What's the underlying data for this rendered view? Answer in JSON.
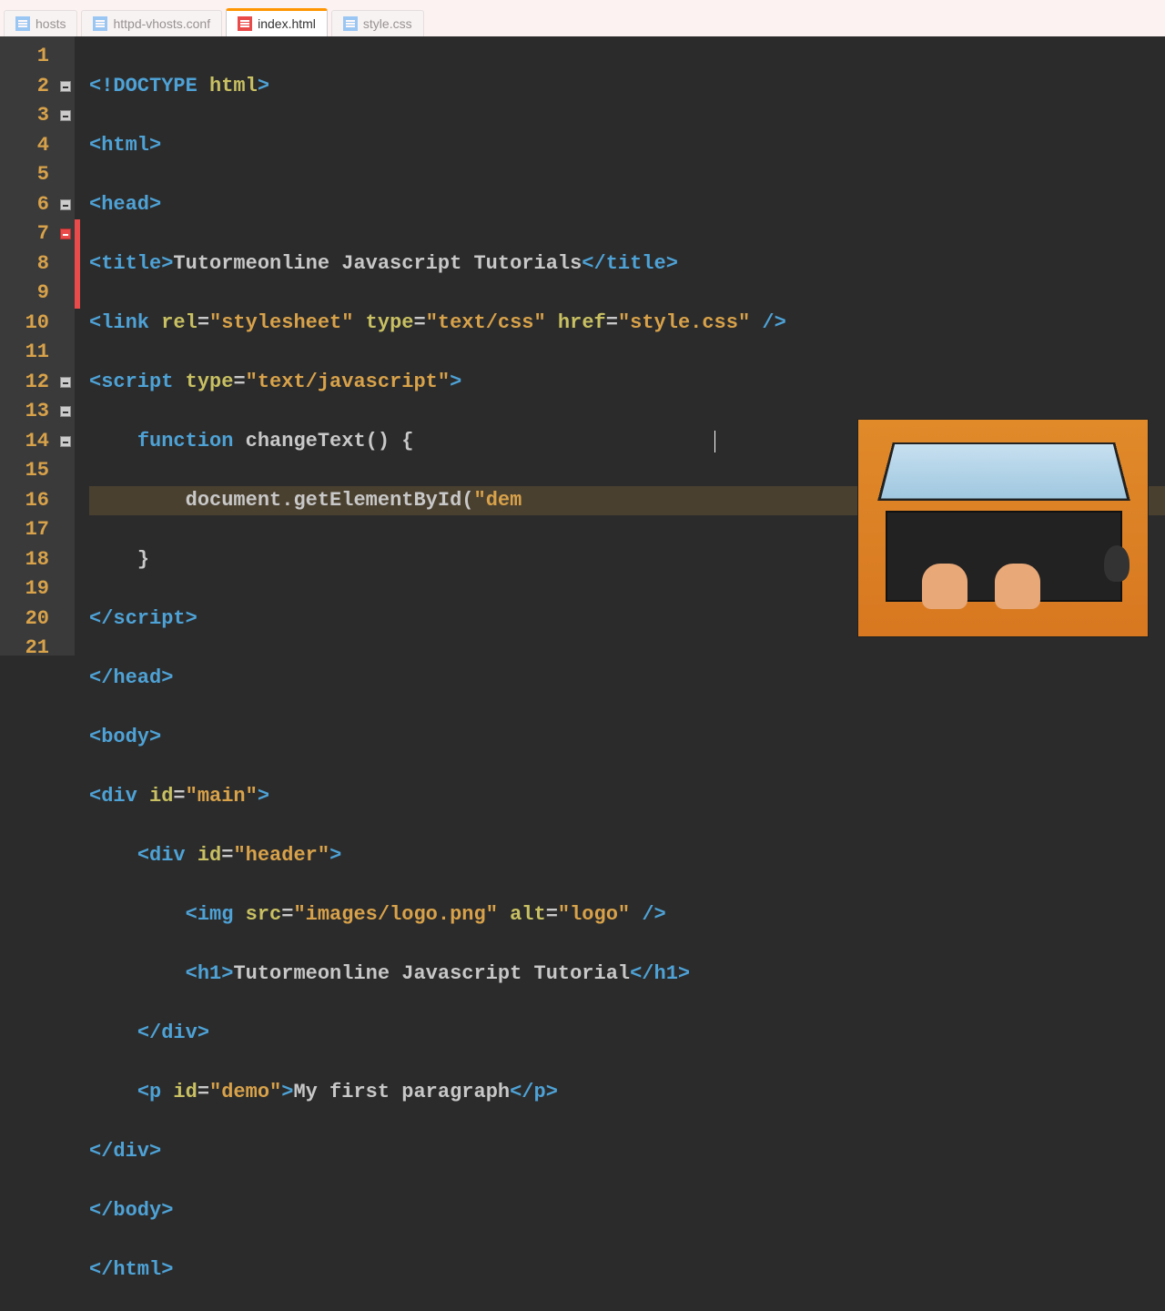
{
  "tabs": [
    {
      "label": "hosts",
      "iconColor": "blue",
      "dim": true
    },
    {
      "label": "httpd-vhosts.conf",
      "iconColor": "blue",
      "dim": true
    },
    {
      "label": "index.html",
      "iconColor": "red",
      "active": true
    },
    {
      "label": "style.css",
      "iconColor": "blue",
      "dim": true
    }
  ],
  "line_numbers": [
    "1",
    "2",
    "3",
    "4",
    "5",
    "6",
    "7",
    "8",
    "9",
    "10",
    "11",
    "12",
    "13",
    "14",
    "15",
    "16",
    "17",
    "18",
    "19",
    "20",
    "21"
  ],
  "fold_markers": {
    "2": "minus",
    "3": "minus",
    "6": "minus",
    "7": "minus-red",
    "12": "minus",
    "13": "minus",
    "14": "minus"
  },
  "change_marks": [
    "7",
    "8",
    "9"
  ],
  "highlighted_line": 8,
  "code": {
    "l1": {
      "t1": "<!DOCTYPE",
      "a1": " html",
      "t2": ">"
    },
    "l2": {
      "t1": "<html>"
    },
    "l3": {
      "t1": "<head>"
    },
    "l4": {
      "t1": "<title>",
      "x1": "Tutormeonline Javascript Tutorials",
      "t2": "</title>"
    },
    "l5": {
      "t1": "<link",
      "a1": " rel",
      "e1": "=",
      "s1": "\"stylesheet\"",
      "a2": " type",
      "e2": "=",
      "s2": "\"text/css\"",
      "a3": " href",
      "e3": "=",
      "s3": "\"style.css\"",
      "t2": " />"
    },
    "l6": {
      "t1": "<script",
      "a1": " type",
      "e1": "=",
      "s1": "\"text/javascript\"",
      "t2": ">"
    },
    "l7": {
      "indent": "    ",
      "k1": "function",
      "sp": " ",
      "fn1": "changeText",
      "p1": "()",
      "sp2": " ",
      "b1": "{"
    },
    "l8": {
      "indent": "        ",
      "fn1": "document",
      "d1": ".",
      "fn2": "getElementById",
      "p1": "(",
      "s1": "\"dem"
    },
    "l9": {
      "indent": "    ",
      "b1": "}"
    },
    "l10_close": "script",
    "l11": {
      "t1": "</head>"
    },
    "l12": {
      "t1": "<body>"
    },
    "l13": {
      "t1": "<div",
      "a1": " id",
      "e1": "=",
      "s1": "\"main\"",
      "t2": ">"
    },
    "l14": {
      "indent": "    ",
      "t1": "<div",
      "a1": " id",
      "e1": "=",
      "s1": "\"header\"",
      "t2": ">"
    },
    "l15": {
      "indent": "        ",
      "t1": "<img",
      "a1": " src",
      "e1": "=",
      "s1": "\"images/logo.png\"",
      "a2": " alt",
      "e2": "=",
      "s2": "\"logo\"",
      "t2": " />"
    },
    "l16": {
      "indent": "        ",
      "t1": "<h1>",
      "x1": "Tutormeonline Javascript Tutorial",
      "t2": "</h1>"
    },
    "l17": {
      "indent": "    ",
      "t1": "</div>"
    },
    "l18": {
      "indent": "    ",
      "t1": "<p",
      "a1": " id",
      "e1": "=",
      "s1": "\"demo\"",
      "t2": ">",
      "x1": "My first paragraph",
      "t3": "</p>"
    },
    "l19": {
      "t1": "</div>"
    },
    "l20": {
      "t1": "</body>"
    },
    "l21": {
      "t1": "</html>"
    }
  }
}
